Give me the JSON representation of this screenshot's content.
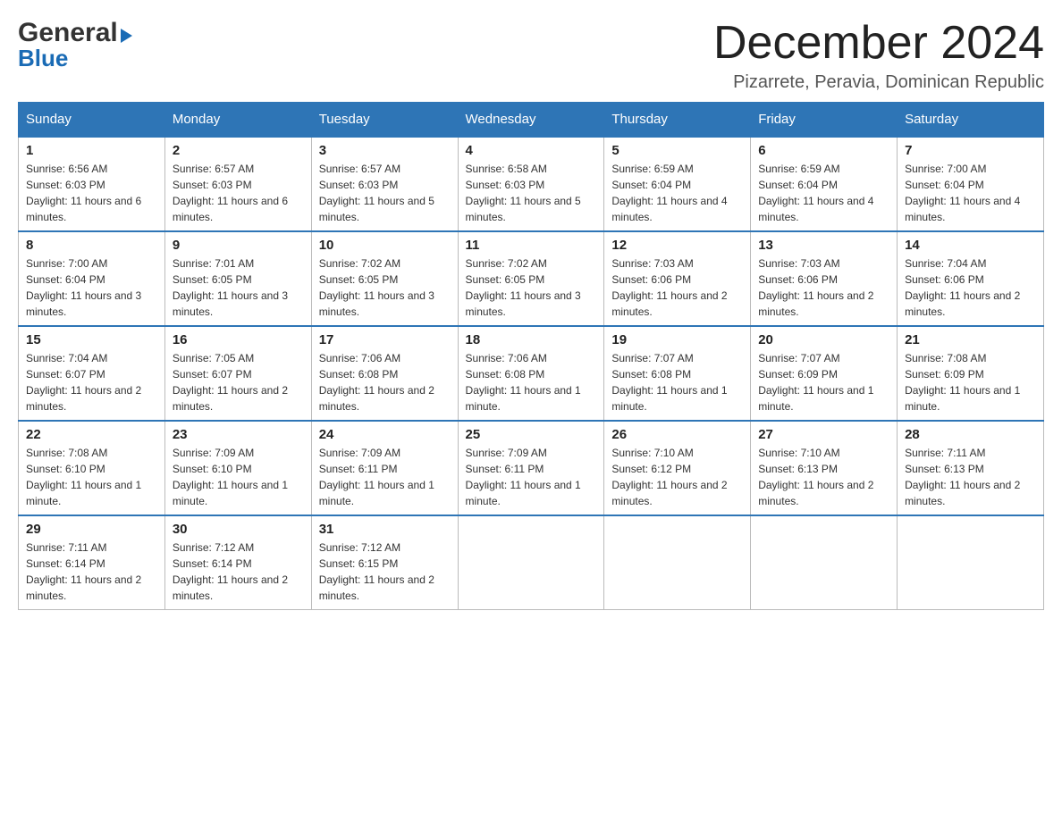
{
  "header": {
    "logo_general": "General",
    "logo_blue": "Blue",
    "month_title": "December 2024",
    "location": "Pizarrete, Peravia, Dominican Republic"
  },
  "days_of_week": [
    "Sunday",
    "Monday",
    "Tuesday",
    "Wednesday",
    "Thursday",
    "Friday",
    "Saturday"
  ],
  "weeks": [
    [
      {
        "num": "1",
        "sunrise": "6:56 AM",
        "sunset": "6:03 PM",
        "daylight": "11 hours and 6 minutes."
      },
      {
        "num": "2",
        "sunrise": "6:57 AM",
        "sunset": "6:03 PM",
        "daylight": "11 hours and 6 minutes."
      },
      {
        "num": "3",
        "sunrise": "6:57 AM",
        "sunset": "6:03 PM",
        "daylight": "11 hours and 5 minutes."
      },
      {
        "num": "4",
        "sunrise": "6:58 AM",
        "sunset": "6:03 PM",
        "daylight": "11 hours and 5 minutes."
      },
      {
        "num": "5",
        "sunrise": "6:59 AM",
        "sunset": "6:04 PM",
        "daylight": "11 hours and 4 minutes."
      },
      {
        "num": "6",
        "sunrise": "6:59 AM",
        "sunset": "6:04 PM",
        "daylight": "11 hours and 4 minutes."
      },
      {
        "num": "7",
        "sunrise": "7:00 AM",
        "sunset": "6:04 PM",
        "daylight": "11 hours and 4 minutes."
      }
    ],
    [
      {
        "num": "8",
        "sunrise": "7:00 AM",
        "sunset": "6:04 PM",
        "daylight": "11 hours and 3 minutes."
      },
      {
        "num": "9",
        "sunrise": "7:01 AM",
        "sunset": "6:05 PM",
        "daylight": "11 hours and 3 minutes."
      },
      {
        "num": "10",
        "sunrise": "7:02 AM",
        "sunset": "6:05 PM",
        "daylight": "11 hours and 3 minutes."
      },
      {
        "num": "11",
        "sunrise": "7:02 AM",
        "sunset": "6:05 PM",
        "daylight": "11 hours and 3 minutes."
      },
      {
        "num": "12",
        "sunrise": "7:03 AM",
        "sunset": "6:06 PM",
        "daylight": "11 hours and 2 minutes."
      },
      {
        "num": "13",
        "sunrise": "7:03 AM",
        "sunset": "6:06 PM",
        "daylight": "11 hours and 2 minutes."
      },
      {
        "num": "14",
        "sunrise": "7:04 AM",
        "sunset": "6:06 PM",
        "daylight": "11 hours and 2 minutes."
      }
    ],
    [
      {
        "num": "15",
        "sunrise": "7:04 AM",
        "sunset": "6:07 PM",
        "daylight": "11 hours and 2 minutes."
      },
      {
        "num": "16",
        "sunrise": "7:05 AM",
        "sunset": "6:07 PM",
        "daylight": "11 hours and 2 minutes."
      },
      {
        "num": "17",
        "sunrise": "7:06 AM",
        "sunset": "6:08 PM",
        "daylight": "11 hours and 2 minutes."
      },
      {
        "num": "18",
        "sunrise": "7:06 AM",
        "sunset": "6:08 PM",
        "daylight": "11 hours and 1 minute."
      },
      {
        "num": "19",
        "sunrise": "7:07 AM",
        "sunset": "6:08 PM",
        "daylight": "11 hours and 1 minute."
      },
      {
        "num": "20",
        "sunrise": "7:07 AM",
        "sunset": "6:09 PM",
        "daylight": "11 hours and 1 minute."
      },
      {
        "num": "21",
        "sunrise": "7:08 AM",
        "sunset": "6:09 PM",
        "daylight": "11 hours and 1 minute."
      }
    ],
    [
      {
        "num": "22",
        "sunrise": "7:08 AM",
        "sunset": "6:10 PM",
        "daylight": "11 hours and 1 minute."
      },
      {
        "num": "23",
        "sunrise": "7:09 AM",
        "sunset": "6:10 PM",
        "daylight": "11 hours and 1 minute."
      },
      {
        "num": "24",
        "sunrise": "7:09 AM",
        "sunset": "6:11 PM",
        "daylight": "11 hours and 1 minute."
      },
      {
        "num": "25",
        "sunrise": "7:09 AM",
        "sunset": "6:11 PM",
        "daylight": "11 hours and 1 minute."
      },
      {
        "num": "26",
        "sunrise": "7:10 AM",
        "sunset": "6:12 PM",
        "daylight": "11 hours and 2 minutes."
      },
      {
        "num": "27",
        "sunrise": "7:10 AM",
        "sunset": "6:13 PM",
        "daylight": "11 hours and 2 minutes."
      },
      {
        "num": "28",
        "sunrise": "7:11 AM",
        "sunset": "6:13 PM",
        "daylight": "11 hours and 2 minutes."
      }
    ],
    [
      {
        "num": "29",
        "sunrise": "7:11 AM",
        "sunset": "6:14 PM",
        "daylight": "11 hours and 2 minutes."
      },
      {
        "num": "30",
        "sunrise": "7:12 AM",
        "sunset": "6:14 PM",
        "daylight": "11 hours and 2 minutes."
      },
      {
        "num": "31",
        "sunrise": "7:12 AM",
        "sunset": "6:15 PM",
        "daylight": "11 hours and 2 minutes."
      },
      null,
      null,
      null,
      null
    ]
  ]
}
